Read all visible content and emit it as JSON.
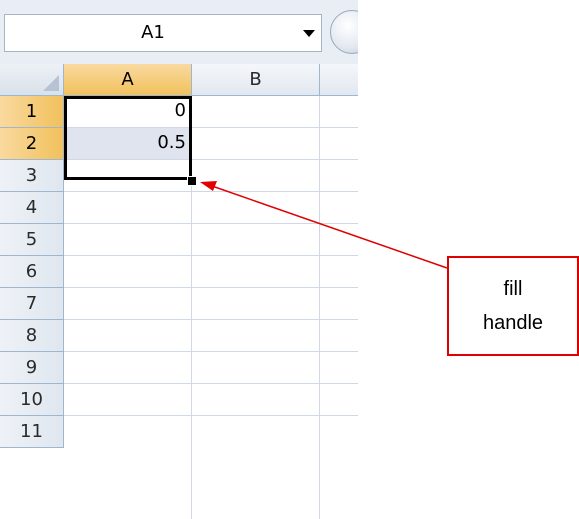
{
  "name_box": {
    "value": "A1"
  },
  "columns": [
    "A",
    "B"
  ],
  "rows": [
    "1",
    "2",
    "3",
    "4",
    "5",
    "6",
    "7",
    "8",
    "9",
    "10",
    "11"
  ],
  "cells": {
    "A1": "0",
    "A2": "0.5"
  },
  "annotation": {
    "line1": "fill",
    "line2": "handle",
    "color": "#e00000"
  }
}
